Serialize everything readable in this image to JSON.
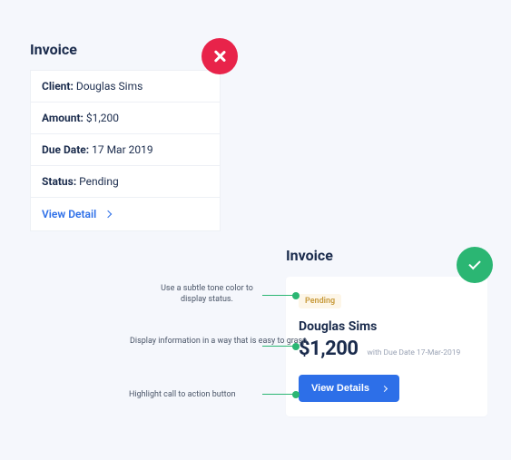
{
  "bad": {
    "title": "Invoice",
    "rows": [
      {
        "label": "Client:",
        "value": " Douglas Sims"
      },
      {
        "label": "Amount:",
        "value": " $1,200"
      },
      {
        "label": "Due Date:",
        "value": " 17 Mar 2019"
      },
      {
        "label": "Status:",
        "value": " Pending"
      }
    ],
    "link": "View Detail"
  },
  "good": {
    "title": "Invoice",
    "status": "Pending",
    "client": "Douglas Sims",
    "amount": "$1,200",
    "due": "with Due Date 17-Mar-2019",
    "cta": "View Details"
  },
  "annotations": {
    "a1": "Use a subtle tone color to display status.",
    "a2": "Display information in a way that is easy to grasp.",
    "a3": "Highlight call to action button"
  }
}
